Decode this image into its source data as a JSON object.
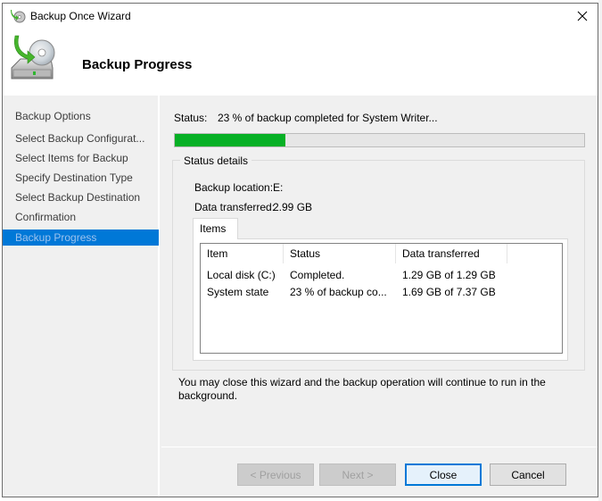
{
  "window": {
    "title": "Backup Once Wizard",
    "close_icon": "close-icon",
    "app_icon": "backup-wizard-icon"
  },
  "header": {
    "title": "Backup Progress",
    "icon": "backup-disk-icon"
  },
  "sidebar": {
    "steps": [
      {
        "label": "Backup Options",
        "active": false
      },
      {
        "label": "Select Backup Configurat...",
        "active": false
      },
      {
        "label": "Select Items for Backup",
        "active": false
      },
      {
        "label": "Specify Destination Type",
        "active": false
      },
      {
        "label": "Select Backup Destination",
        "active": false
      },
      {
        "label": "Confirmation",
        "active": false
      },
      {
        "label": "Backup Progress",
        "active": true
      }
    ]
  },
  "status": {
    "label": "Status:",
    "text": "23 % of backup completed for System Writer...",
    "progress_percent": 27,
    "progress_color": "#06b025"
  },
  "details": {
    "legend": "Status details",
    "backup_location_label": "Backup location:",
    "backup_location_value": "E:",
    "data_transferred_label": "Data transferred:",
    "data_transferred_value": "2.99 GB"
  },
  "items_tab": {
    "label": "Items",
    "columns": [
      "Item",
      "Status",
      "Data transferred"
    ],
    "rows": [
      {
        "item": "Local disk (C:)",
        "status": "Completed.",
        "data": "1.29 GB of 1.29 GB"
      },
      {
        "item": "System state",
        "status": "23 % of backup co...",
        "data": "1.69 GB of 7.37 GB"
      }
    ]
  },
  "info_text": "You may close this wizard and the backup operation will continue to run in the background.",
  "buttons": {
    "previous": "< Previous",
    "next": "Next >",
    "close": "Close",
    "cancel": "Cancel"
  },
  "colors": {
    "accent": "#0078d7",
    "progress": "#06b025"
  }
}
